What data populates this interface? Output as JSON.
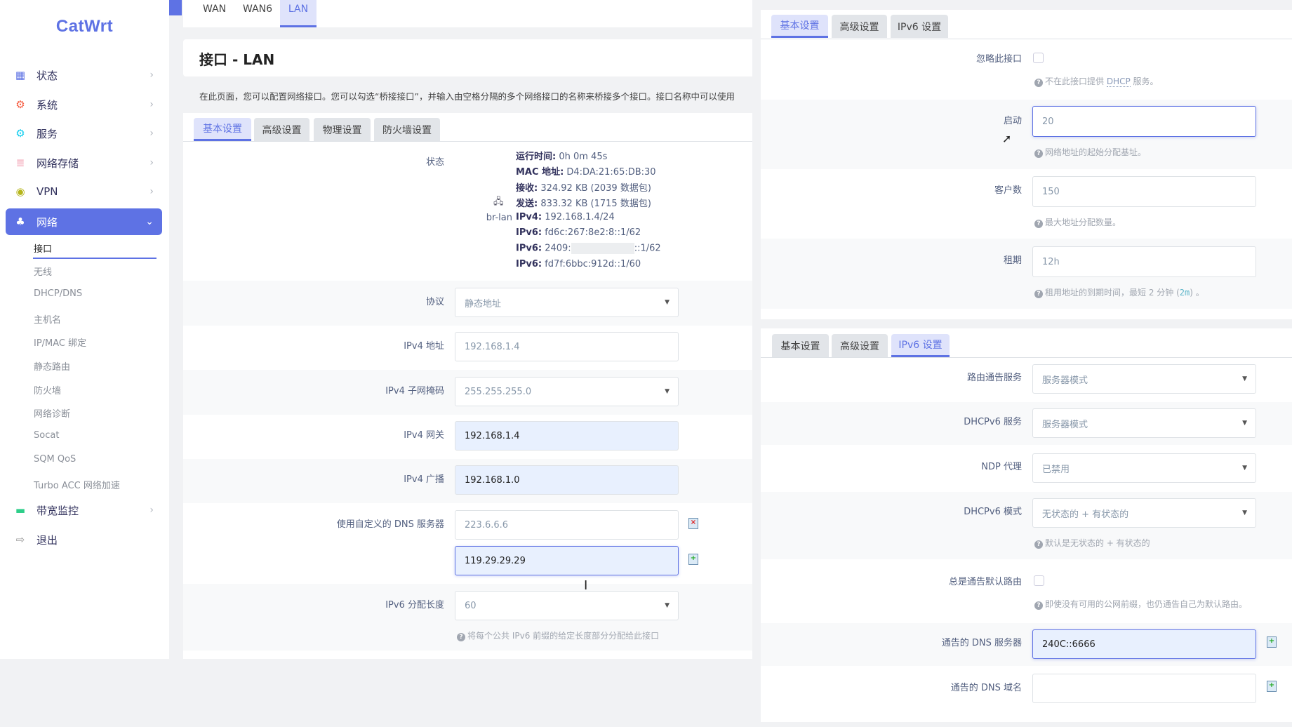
{
  "sidebar": {
    "logo": "CatWrt",
    "items": [
      {
        "label": "状态",
        "icon": "dashboard-icon"
      },
      {
        "label": "系统",
        "icon": "gear-icon"
      },
      {
        "label": "服务",
        "icon": "services-icon"
      },
      {
        "label": "网络存储",
        "icon": "database-icon"
      },
      {
        "label": "VPN",
        "icon": "vpn-icon"
      },
      {
        "label": "网络",
        "icon": "network-icon"
      },
      {
        "label": "带宽监控",
        "icon": "monitor-icon"
      },
      {
        "label": "退出",
        "icon": "logout-icon"
      }
    ],
    "sub_items": [
      "接口",
      "无线",
      "DHCP/DNS",
      "主机名",
      "IP/MAC 绑定",
      "静态路由",
      "防火墙",
      "网络诊断",
      "Socat",
      "SQM QoS",
      "Turbo ACC 网络加速"
    ]
  },
  "iface_tabs": [
    "WAN",
    "WAN6",
    "LAN"
  ],
  "page": {
    "title": "接口 - LAN",
    "description": "在此页面，您可以配置网络接口。您可以勾选“桥接接口”，并输入由空格分隔的多个网络接口的名称来桥接多个接口。接口名称中可以使用"
  },
  "left": {
    "tabs": [
      "基本设置",
      "高级设置",
      "物理设置",
      "防火墙设置"
    ],
    "status": {
      "label": "状态",
      "device": "br-lan",
      "lines": [
        {
          "k": "运行时间:",
          "v": " 0h 0m 45s"
        },
        {
          "k": "MAC 地址:",
          "v": " D4:DA:21:65:DB:30"
        },
        {
          "k": "接收:",
          "v": " 324.92 KB (2039 数据包)"
        },
        {
          "k": "发送:",
          "v": " 833.32 KB (1715 数据包)"
        },
        {
          "k": "IPv4:",
          "v": " 192.168.1.4/24"
        },
        {
          "k": "IPv6:",
          "v": " fd6c:267:8e2:8::1/62"
        },
        {
          "k": "IPv6:",
          "v": " 2409:"
        },
        {
          "k": "IPv6:",
          "v": " fd7f:6bbc:912d::1/60"
        }
      ],
      "ipv6_suffix": "::1/62"
    },
    "protocol": {
      "label": "协议",
      "value": "静态地址"
    },
    "ipv4_addr": {
      "label": "IPv4 地址",
      "value": "192.168.1.4"
    },
    "ipv4_mask": {
      "label": "IPv4 子网掩码",
      "value": "255.255.255.0"
    },
    "ipv4_gw": {
      "label": "IPv4 网关",
      "value": "192.168.1.4"
    },
    "ipv4_bcast": {
      "label": "IPv4 广播",
      "value": "192.168.1.0"
    },
    "dns": {
      "label": "使用自定义的 DNS 服务器",
      "values": [
        "223.6.6.6",
        "119.29.29.29"
      ]
    },
    "ipv6_len": {
      "label": "IPv6 分配长度",
      "value": "60",
      "hint": "将每个公共 IPv6 前缀的给定长度部分分配给此接口"
    }
  },
  "dhcp": {
    "tabs": [
      "基本设置",
      "高级设置",
      "IPv6 设置"
    ],
    "ignore": {
      "label": "忽略此接口",
      "hint_pre": "不在此接口提供 ",
      "hint_link": "DHCP",
      "hint_post": " 服务。"
    },
    "start": {
      "label": "启动",
      "value": "20",
      "hint": "网络地址的起始分配基址。"
    },
    "limit": {
      "label": "客户数",
      "value": "150",
      "hint": "最大地址分配数量。"
    },
    "lease": {
      "label": "租期",
      "value": "12h",
      "hint_pre": "租用地址的到期时间，最短 2 分钟 (",
      "hint_code": "2m",
      "hint_post": ") 。"
    }
  },
  "ipv6": {
    "tabs": [
      "基本设置",
      "高级设置",
      "IPv6 设置"
    ],
    "ra": {
      "label": "路由通告服务",
      "value": "服务器模式"
    },
    "dhcpv6": {
      "label": "DHCPv6 服务",
      "value": "服务器模式"
    },
    "ndp": {
      "label": "NDP 代理",
      "value": "已禁用"
    },
    "mode": {
      "label": "DHCPv6 模式",
      "value": "无状态的 + 有状态的",
      "hint": "默认是无状态的 + 有状态的"
    },
    "default_route": {
      "label": "总是通告默认路由",
      "hint": "即使没有可用的公网前缀，也仍通告自己为默认路由。"
    },
    "dns": {
      "label": "通告的 DNS 服务器",
      "value": "240C::6666"
    },
    "domain": {
      "label": "通告的 DNS 域名",
      "value": ""
    }
  },
  "colors": {
    "accent": "#5e72e4"
  }
}
